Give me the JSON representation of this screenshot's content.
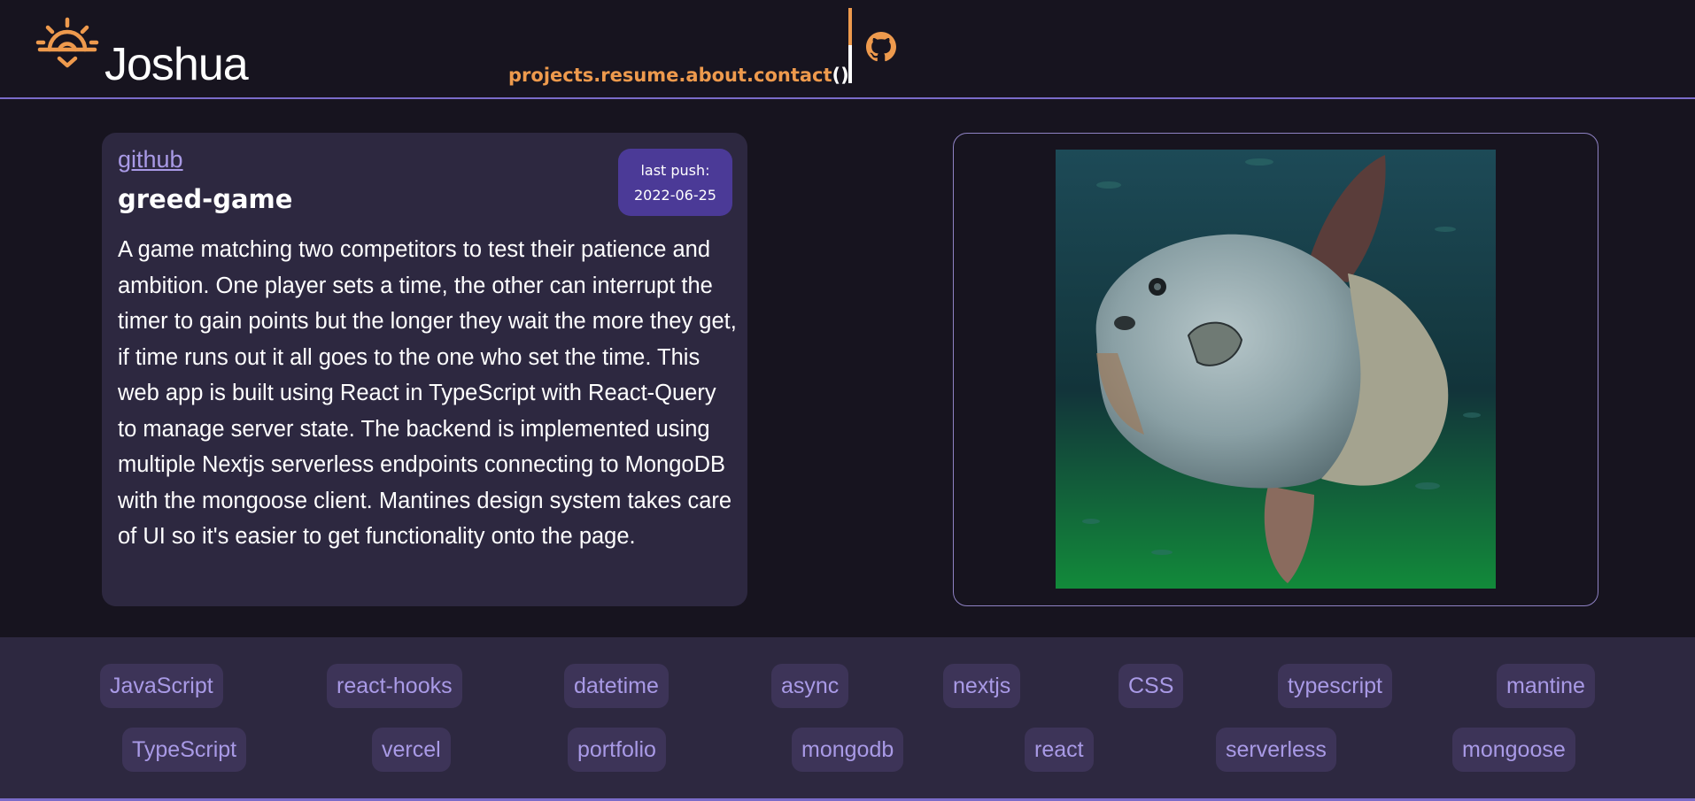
{
  "header": {
    "brand": "Joshua",
    "nav": {
      "projects": "projects",
      "resume": "resume",
      "about": "about",
      "contact": "contact",
      "separator": ".",
      "parens": "()"
    },
    "accent_color": "#ee9a4d",
    "logo_icon": "sun-icon",
    "social_icon": "github-icon"
  },
  "project": {
    "repo_link": "github",
    "title": "greed-game",
    "last_push_label": "last push:",
    "last_push_date": "2022-06-25",
    "description": "A game matching two competitors to test their patience and ambition. One player sets a time, the other can interrupt the timer to gain points but the longer they wait the more they get, if time runs out it all goes to the one who set the time. This web app is built using React in TypeScript with React-Query to manage server state. The backend is implemented using multiple Nextjs serverless endpoints connecting to MongoDB with the mongoose client. Mantines design system takes care of UI so it's easier to get functionality onto the page.",
    "image": "sunfish-photo"
  },
  "tags": {
    "row1": [
      "JavaScript",
      "react-hooks",
      "datetime",
      "async",
      "nextjs",
      "CSS",
      "typescript",
      "mantine"
    ],
    "row2": [
      "TypeScript",
      "vercel",
      "portfolio",
      "mongodb",
      "react",
      "serverless",
      "mongoose"
    ]
  },
  "colors": {
    "background": "#17141f",
    "card": "#2d2840",
    "tag_bg": "#3d3458",
    "tag_text": "#a99ae6",
    "badge": "#4b3a97",
    "rule": "#7a6bc9"
  }
}
